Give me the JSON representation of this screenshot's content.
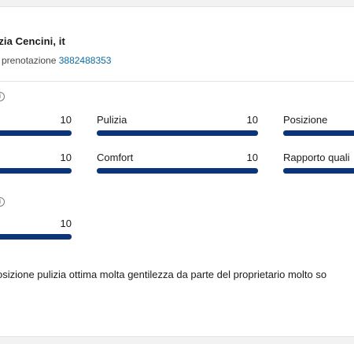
{
  "review": {
    "guest_name": "azia Cencini, it",
    "booking_label": "i prenotazione",
    "booking_number": "3882488353",
    "text": "osizione pulizia ottima molta gentilezza da parte del proprietario molto so"
  },
  "scores": {
    "row1": {
      "col1": {
        "value": "10",
        "level": 1.0
      },
      "col2": {
        "label": "Pulizia",
        "value": "10",
        "level": 1.0
      },
      "col3": {
        "label": "Posizione",
        "level": 1.0
      }
    },
    "row2": {
      "col1": {
        "value": "10",
        "level": 1.0
      },
      "col2": {
        "label": "Comfort",
        "value": "10",
        "level": 1.0
      },
      "col3": {
        "label": "Rapporto quali",
        "level": 1.0
      }
    },
    "row3": {
      "col1": {
        "value": "10",
        "level": 1.0
      }
    }
  },
  "colors": {
    "bar_fill": "#0c3479",
    "link": "#0a6ba3"
  },
  "icons": [
    "info-icon"
  ]
}
